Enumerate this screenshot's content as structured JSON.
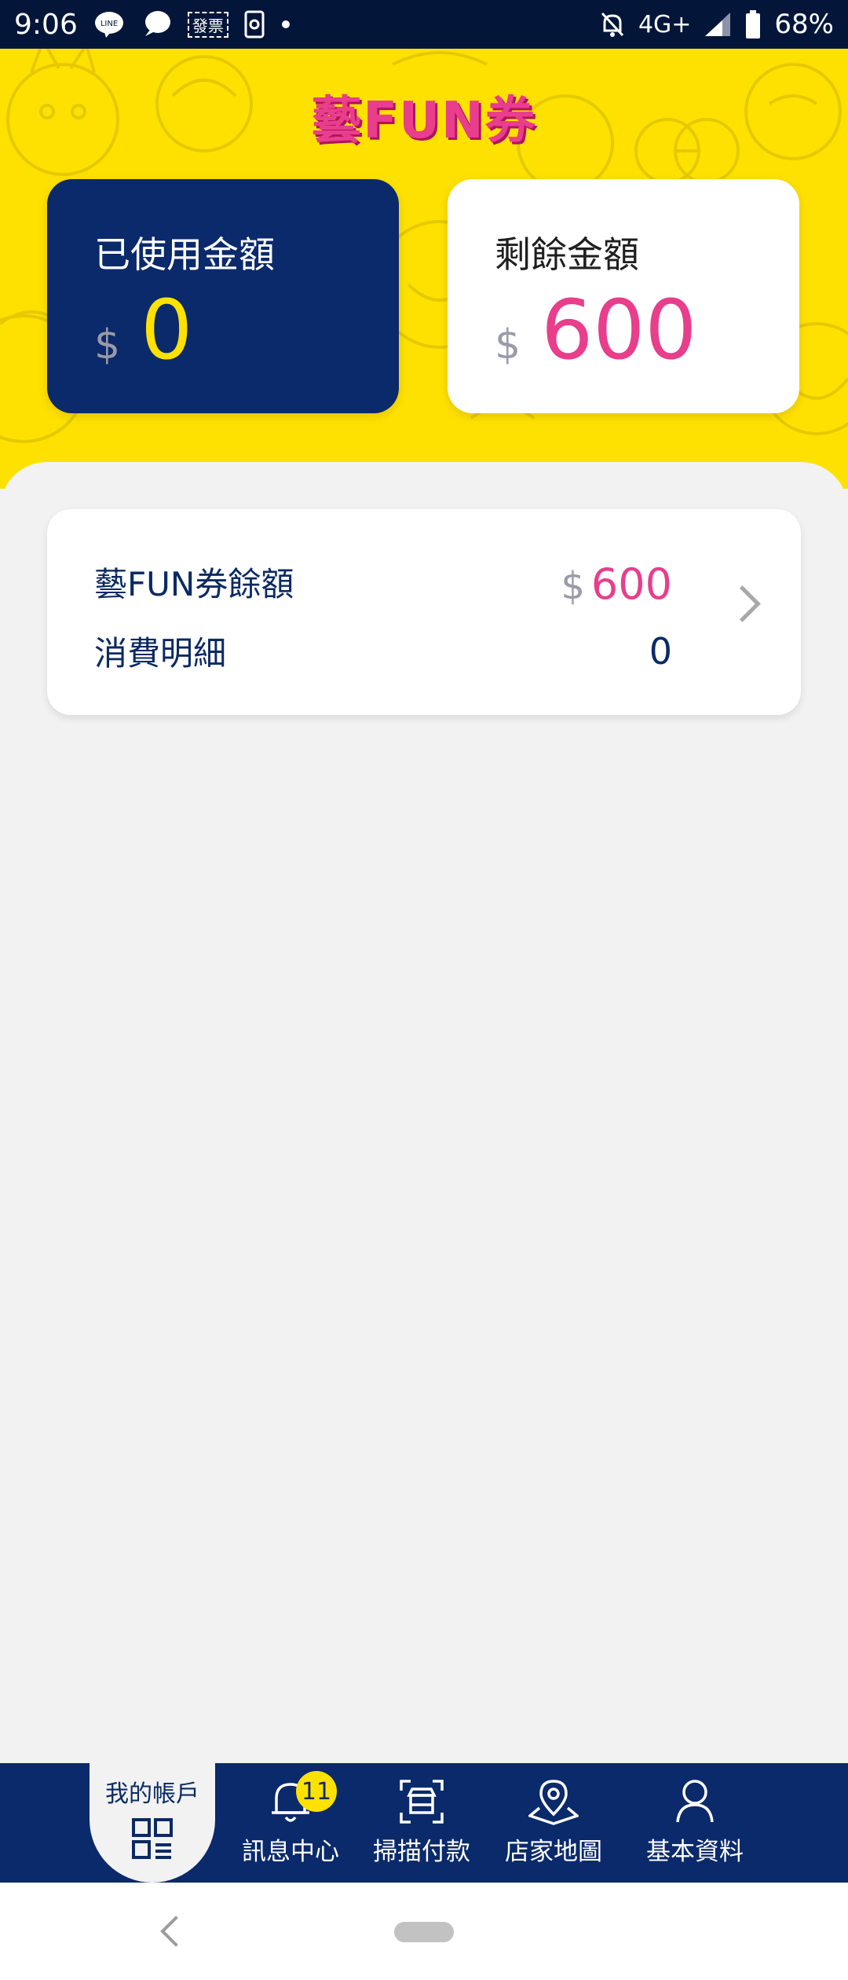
{
  "status_bar": {
    "time": "9:06",
    "notification_text": "發票",
    "network": "4G+",
    "battery": "68%",
    "icons": [
      "line-icon",
      "chat-icon",
      "invoice-icon",
      "screen-record-icon",
      "dot-icon",
      "mute-icon",
      "signal-icon",
      "battery-icon"
    ]
  },
  "header": {
    "logo": "藝FUN券",
    "used_label": "已使用金額",
    "used_currency": "$",
    "used_amount": "0",
    "remaining_label": "剩餘金額",
    "remaining_currency": "$",
    "remaining_amount": "600"
  },
  "summary": {
    "balance_label": "藝FUN券餘額",
    "balance_currency": "$",
    "balance_value": "600",
    "spend_label": "消費明細",
    "spend_value": "0"
  },
  "bottom_nav": {
    "items": [
      {
        "label": "我的帳戶",
        "icon": "account-grid-icon",
        "active": true
      },
      {
        "label": "訊息中心",
        "icon": "bell-icon",
        "badge": "11"
      },
      {
        "label": "掃描付款",
        "icon": "scan-store-icon"
      },
      {
        "label": "店家地圖",
        "icon": "map-pin-icon"
      },
      {
        "label": "基本資料",
        "icon": "person-icon"
      }
    ]
  },
  "colors": {
    "navy": "#0a2a6b",
    "yellow": "#ffe100",
    "pink": "#e83e8c"
  }
}
